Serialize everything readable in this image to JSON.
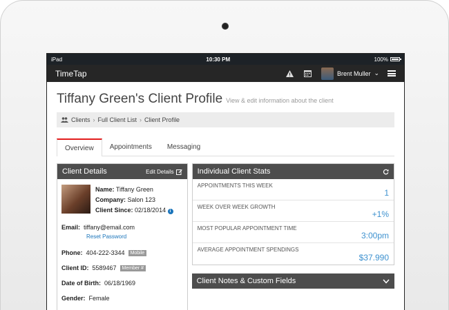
{
  "status_bar": {
    "device": "iPad",
    "time": "10:30 PM",
    "battery": "100%"
  },
  "app_bar": {
    "brand": "TimeTap",
    "user_name": "Brent Muller"
  },
  "page": {
    "title": "Tiffany Green's Client Profile",
    "subtitle": "View & edit information about the client"
  },
  "breadcrumb": [
    "Clients",
    "Full Client List",
    "Client Profile"
  ],
  "tabs": [
    "Overview",
    "Appointments",
    "Messaging"
  ],
  "client_details": {
    "header": "Client Details",
    "edit_label": "Edit Details",
    "name_label": "Name:",
    "name": "Tiffany Green",
    "company_label": "Company:",
    "company": "Salon 123",
    "since_label": "Client Since:",
    "since": "02/18/2014",
    "email_label": "Email:",
    "email": "tiffany@email.com",
    "reset_label": "Reset Password",
    "phone_label": "Phone:",
    "phone": "404-222-3344",
    "phone_tag": "Mobile",
    "client_id_label": "Client ID:",
    "client_id": "5589467",
    "client_id_tag": "Member #",
    "dob_label": "Date of Birth:",
    "dob": "06/18/1969",
    "gender_label": "Gender:",
    "gender": "Female"
  },
  "stats": {
    "header": "Individual Client Stats",
    "rows": [
      {
        "label": "Appointments this week",
        "value": "1"
      },
      {
        "label": "Week over week growth",
        "value": "+1%"
      },
      {
        "label": "Most popular appointment time",
        "value": "3:00pm"
      },
      {
        "label": "Average appointment spendings",
        "value": "$37.990"
      }
    ]
  },
  "notes": {
    "header": "Client Notes & Custom Fields"
  }
}
